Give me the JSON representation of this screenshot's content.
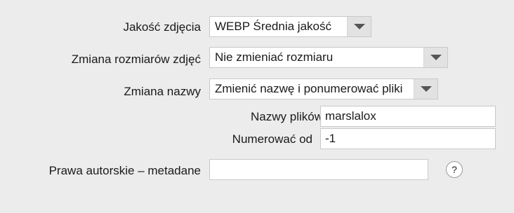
{
  "quality": {
    "label": "Jakość zdjęcia",
    "value": "WEBP Średnia jakość"
  },
  "resize": {
    "label": "Zmiana rozmiarów zdjęć",
    "value": "Nie zmieniać rozmiaru"
  },
  "rename": {
    "label": "Zmiana nazwy",
    "value": "Zmienić nazwę i ponumerować pliki",
    "file_names": {
      "label": "Nazwy plików",
      "value": "marslalox"
    },
    "number_from": {
      "label": "Numerować od",
      "value": "-1"
    }
  },
  "copyright": {
    "label": "Prawa autorskie – metadane",
    "value": "",
    "help_glyph": "?"
  },
  "icons": {
    "dropdown": "chevron-down-icon",
    "help": "help-icon"
  }
}
